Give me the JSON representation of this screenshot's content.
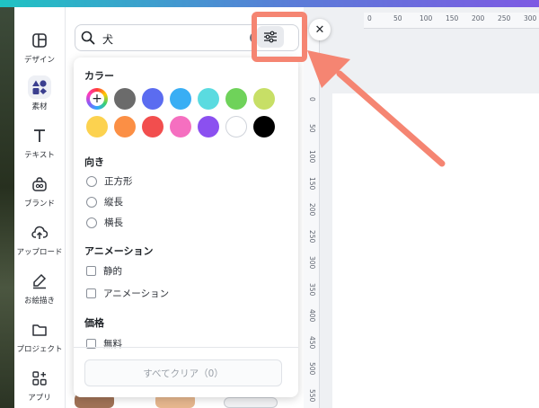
{
  "sidebar": {
    "items": [
      {
        "label": "デザイン",
        "icon": "design-layout-icon"
      },
      {
        "label": "素材",
        "icon": "elements-icon",
        "active": true
      },
      {
        "label": "テキスト",
        "icon": "text-icon"
      },
      {
        "label": "ブランド",
        "icon": "brand-icon"
      },
      {
        "label": "アップロード",
        "icon": "upload-cloud-icon"
      },
      {
        "label": "お絵描き",
        "icon": "draw-pen-icon"
      },
      {
        "label": "プロジェクト",
        "icon": "folder-icon"
      },
      {
        "label": "アプリ",
        "icon": "apps-grid-icon"
      }
    ]
  },
  "search": {
    "value": "犬"
  },
  "filters": {
    "color": {
      "title": "カラー",
      "swatches": [
        "#6b6b6b",
        "#5b6cf0",
        "#39aef4",
        "#5adbe0",
        "#6fd25a",
        "#c7df66",
        "#fcd24f",
        "#fb8f45",
        "#f24e4e",
        "#f56fc0",
        "#8b50f0",
        "#ffffff",
        "#000000"
      ]
    },
    "orientation": {
      "title": "向き",
      "options": [
        "正方形",
        "縦長",
        "横長"
      ]
    },
    "animation": {
      "title": "アニメーション",
      "options": [
        "静的",
        "アニメーション"
      ]
    },
    "price": {
      "title": "価格",
      "options": [
        "無料"
      ]
    },
    "clear_all_label": "すべてクリア（0）"
  },
  "ruler": {
    "top_ticks": [
      "0",
      "50",
      "100",
      "150",
      "200",
      "250",
      "300"
    ],
    "left_ticks": [
      "0",
      "50",
      "100",
      "150",
      "200",
      "250",
      "300",
      "350",
      "400",
      "450",
      "500",
      "550"
    ]
  },
  "colors": {
    "accent_arrow": "#f58572",
    "brand_gradient_start": "#1fc3c3",
    "brand_gradient_end": "#7d5ae3"
  }
}
